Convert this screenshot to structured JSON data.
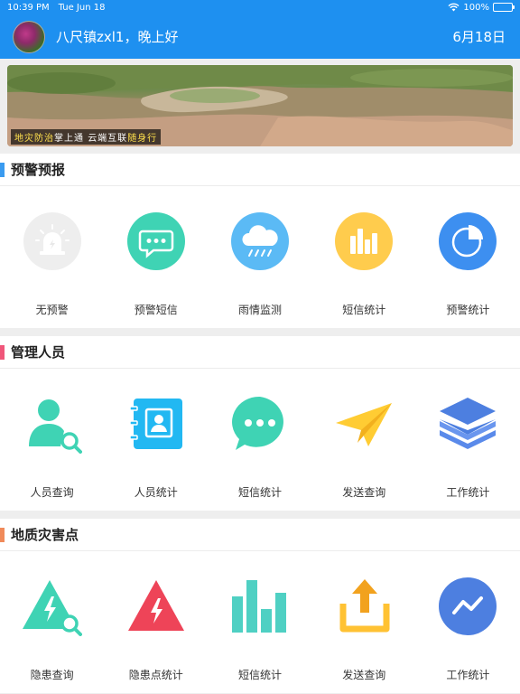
{
  "status_bar": {
    "time": "10:39 PM",
    "date": "Tue Jun 18",
    "battery": "100%",
    "battery_level": 1.0
  },
  "header": {
    "greeting": "八尺镇zxl1，晚上好",
    "date": "6月18日"
  },
  "banner": {
    "caption_yellow_1": "地灾防治",
    "caption_white_1": "掌上通",
    "caption_white_2": "云端互联",
    "caption_yellow_2": "随身行"
  },
  "sections": [
    {
      "title": "预警预报",
      "accent": "#3a9bf0",
      "items": [
        {
          "label": "无预警",
          "icon": "alarm-light-icon"
        },
        {
          "label": "预警短信",
          "icon": "chat-bubble-icon"
        },
        {
          "label": "雨情监测",
          "icon": "rain-cloud-icon"
        },
        {
          "label": "短信统计",
          "icon": "bar-chart-icon"
        },
        {
          "label": "预警统计",
          "icon": "pie-chart-icon"
        }
      ]
    },
    {
      "title": "管理人员",
      "accent": "#f0567a",
      "items": [
        {
          "label": "人员查询",
          "icon": "person-search-icon"
        },
        {
          "label": "人员统计",
          "icon": "contact-book-icon"
        },
        {
          "label": "短信统计",
          "icon": "message-dots-icon"
        },
        {
          "label": "发送查询",
          "icon": "paper-plane-icon"
        },
        {
          "label": "工作统计",
          "icon": "layers-icon"
        }
      ]
    },
    {
      "title": "地质灾害点",
      "accent": "#f08a5a",
      "items": [
        {
          "label": "隐患查询",
          "icon": "hazard-search-icon"
        },
        {
          "label": "隐患点统计",
          "icon": "hazard-warning-icon"
        },
        {
          "label": "短信统计",
          "icon": "column-chart-icon"
        },
        {
          "label": "发送查询",
          "icon": "share-upload-icon"
        },
        {
          "label": "工作统计",
          "icon": "trend-line-icon"
        }
      ]
    }
  ]
}
